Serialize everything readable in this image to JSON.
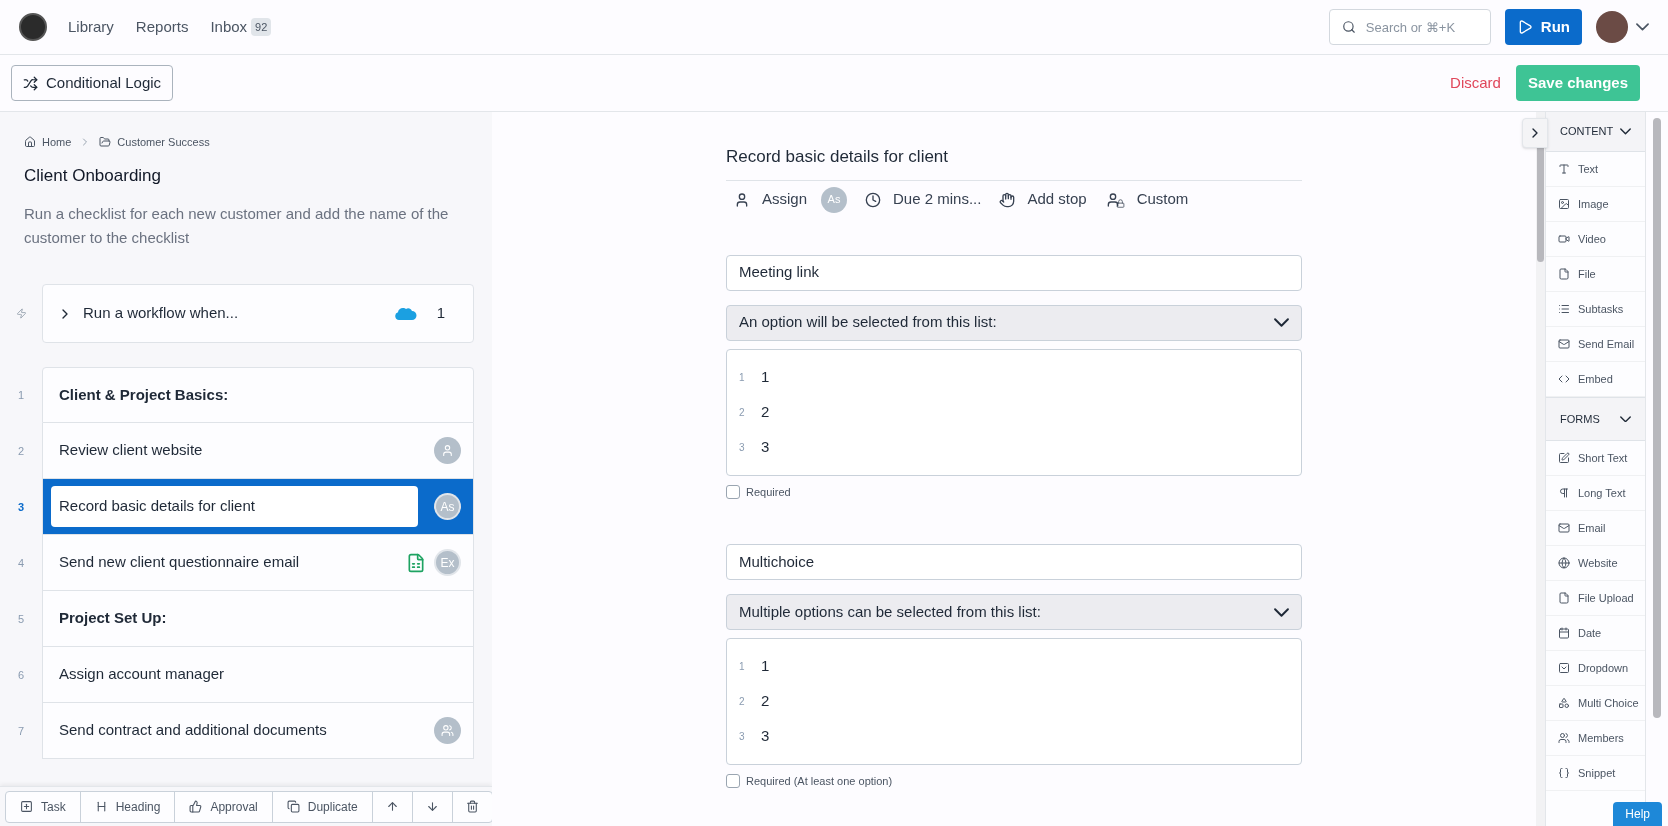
{
  "nav": {
    "links": [
      {
        "label": "Library"
      },
      {
        "label": "Reports"
      },
      {
        "label": "Inbox",
        "badge": "92"
      }
    ],
    "search": {
      "placeholder": "Search or ⌘+K"
    },
    "run": "Run"
  },
  "toolbar": {
    "logic": "Conditional Logic",
    "discard": "Discard",
    "save": "Save changes"
  },
  "left": {
    "breadcrumb": [
      {
        "label": "Home",
        "kind": "home"
      },
      {
        "label": "Customer Success",
        "kind": "folder"
      }
    ],
    "title": "Client Onboarding",
    "description": "Run a checklist for each new customer and add the name of the customer to the checklist",
    "trigger": {
      "label": "Run a workflow when...",
      "count": "1"
    },
    "tasks": [
      {
        "number": "1",
        "label": "Client & Project Basics:",
        "kind": "heading",
        "selected": false
      },
      {
        "number": "2",
        "label": "Review client website",
        "kind": "task",
        "selected": false,
        "assignee": {
          "kind": "user"
        }
      },
      {
        "number": "3",
        "label": "Record basic details for client",
        "kind": "task",
        "selected": true,
        "assignee": {
          "kind": "initials",
          "text": "As"
        }
      },
      {
        "number": "4",
        "label": "Send new client questionnaire email",
        "kind": "task",
        "selected": false,
        "attachment": {
          "kind": "spreadsheet"
        },
        "assignee": {
          "kind": "initials",
          "text": "Ex"
        }
      },
      {
        "number": "5",
        "label": "Project Set Up:",
        "kind": "heading",
        "selected": false
      },
      {
        "number": "6",
        "label": "Assign account manager",
        "kind": "task",
        "selected": false
      },
      {
        "number": "7",
        "label": "Send contract and additional documents",
        "kind": "task",
        "selected": false,
        "assignee": {
          "kind": "group"
        }
      }
    ],
    "actions": [
      {
        "label": "Task",
        "kind": "plus"
      },
      {
        "label": "Heading",
        "kind": "heading"
      },
      {
        "label": "Approval",
        "kind": "thumb"
      },
      {
        "label": "Duplicate",
        "kind": "copy"
      },
      {
        "kind": "up"
      },
      {
        "kind": "down"
      },
      {
        "kind": "trash"
      }
    ]
  },
  "task": {
    "title": "Record basic details for client",
    "meta": [
      {
        "kind": "assign",
        "label": "Assign",
        "initials": "As"
      },
      {
        "kind": "due",
        "label": "Due 2 mins..."
      },
      {
        "kind": "stop",
        "label": "Add stop"
      },
      {
        "kind": "custom",
        "label": "Custom"
      }
    ],
    "fields": [
      {
        "label": "Meeting link",
        "mode": "An option will be selected from this list:",
        "options": [
          {
            "number": "1",
            "value": "1"
          },
          {
            "number": "2",
            "value": "2"
          },
          {
            "number": "3",
            "value": "3"
          }
        ],
        "required": {
          "label": "Required",
          "checked": false
        }
      },
      {
        "label": "Multichoice",
        "mode": "Multiple options can be selected from this list:",
        "options": [
          {
            "number": "1",
            "value": "1"
          },
          {
            "number": "2",
            "value": "2"
          },
          {
            "number": "3",
            "value": "3"
          }
        ],
        "required": {
          "label": "Required (At least one option)",
          "checked": false
        }
      }
    ]
  },
  "sidebar": {
    "sections": [
      {
        "title": "CONTENT",
        "expanded": true,
        "items": [
          {
            "label": "Text",
            "kind": "text"
          },
          {
            "label": "Image",
            "kind": "image"
          },
          {
            "label": "Video",
            "kind": "video"
          },
          {
            "label": "File",
            "kind": "file"
          },
          {
            "label": "Subtasks",
            "kind": "list"
          },
          {
            "label": "Send Email",
            "kind": "mail"
          },
          {
            "label": "Embed",
            "kind": "code"
          }
        ]
      },
      {
        "title": "FORMS",
        "expanded": true,
        "items": [
          {
            "label": "Short Text",
            "kind": "pen"
          },
          {
            "label": "Long Text",
            "kind": "pilcrow"
          },
          {
            "label": "Email",
            "kind": "mail"
          },
          {
            "label": "Website",
            "kind": "globe"
          },
          {
            "label": "File Upload",
            "kind": "file"
          },
          {
            "label": "Date",
            "kind": "calendar"
          },
          {
            "label": "Dropdown",
            "kind": "dropdown"
          },
          {
            "label": "Multi Choice",
            "kind": "shapes"
          },
          {
            "label": "Members",
            "kind": "users"
          },
          {
            "label": "Snippet",
            "kind": "braces"
          }
        ]
      }
    ]
  },
  "help": "Help"
}
